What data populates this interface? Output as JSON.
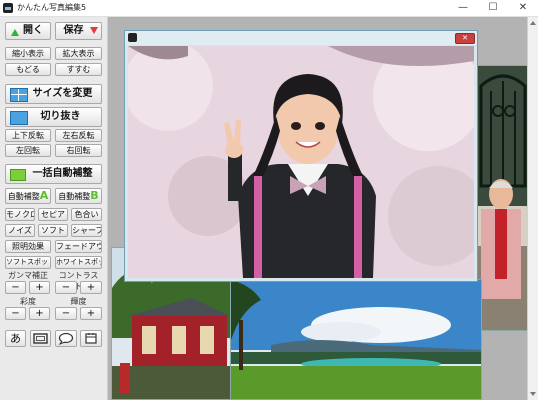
{
  "window": {
    "title": "かんたん写真編集5",
    "min_glyph": "—",
    "max_glyph": "☐",
    "close_glyph": "✕"
  },
  "toolbar": {
    "open": "開く",
    "save": "保存",
    "zoom_out": "縮小表示",
    "zoom_in": "拡大表示",
    "undo": "もどる",
    "redo": "すすむ",
    "resize": "サイズを変更",
    "crop": "切り抜き",
    "flip_v": "上下反転",
    "flip_h": "左右反転",
    "rotate_l": "左回転",
    "rotate_r": "右回転",
    "auto_all": "一括自動補整",
    "auto_a": "自動補整",
    "auto_a_letter": "A",
    "auto_b": "自動補整",
    "auto_b_letter": "B",
    "mono": "モノクロ",
    "sepia": "セピア",
    "tint": "色合い",
    "noise": "ノイズ",
    "soft": "ソフト",
    "sharp": "シャープ",
    "lighting": "照明効果",
    "fadeout": "フェードアウト",
    "softspot": "ソフトスポット",
    "whitespot": "ホワイトスポット",
    "gamma": "ガンマ補正",
    "contrast": "コントラスト",
    "saturation": "彩度",
    "brightness": "輝度",
    "minus": "−",
    "plus": "+",
    "text_tool": "あ"
  },
  "icons": {
    "frame": "frame-icon",
    "balloon": "speech-balloon-icon",
    "calendar": "calendar-icon"
  },
  "colors": {
    "accent_green": "#5bbf2d",
    "save_arrow": "#e53a3a",
    "open_arrow": "#2fb52f",
    "blue_icon": "#4aa3df"
  }
}
